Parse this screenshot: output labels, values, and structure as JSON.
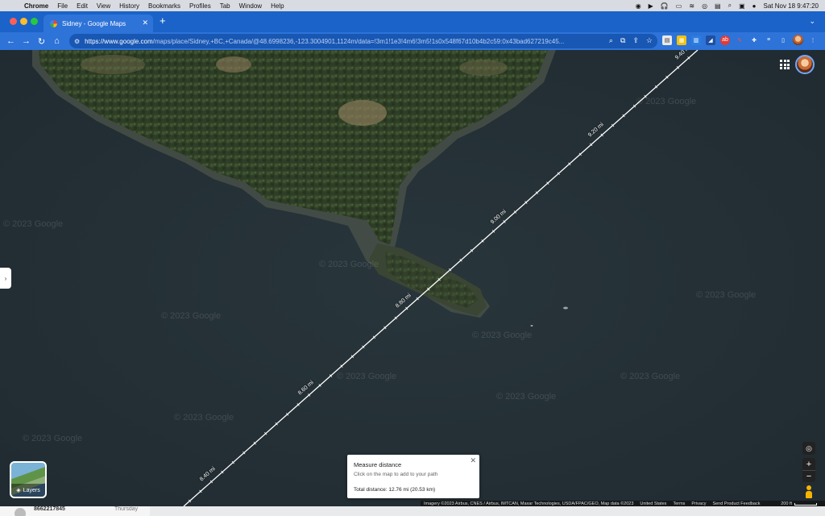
{
  "menubar": {
    "items": [
      "Chrome",
      "File",
      "Edit",
      "View",
      "History",
      "Bookmarks",
      "Profiles",
      "Tab",
      "Window",
      "Help"
    ],
    "datetime": "Sat Nov 18  9:47:20"
  },
  "tab": {
    "title": "Sidney - Google Maps"
  },
  "address_bar": {
    "url_host": "https://www.google.com",
    "url_rest": "/maps/place/Sidney,+BC,+Canada/@48.6998236,-123.3004901,1124m/data=!3m1!1e3!4m6!3m5!1s0x548f67d10b4b2c59:0x43bad627219c45..."
  },
  "map": {
    "watermark": "© 2023 Google",
    "ruler_labels": [
      "8.40 mi",
      "8.60 mi",
      "8.80 mi",
      "9.00 mi",
      "9.20 mi",
      "9.40 mi"
    ],
    "layers_label": "Layers"
  },
  "measure_panel": {
    "title": "Measure distance",
    "hint": "Click on the map to add to your path",
    "total": "Total distance: 12.76 mi (20.53 km)"
  },
  "attribution": {
    "imagery": "Imagery ©2023 Airbus, CNES / Airbus, IMTCAN, Maxar Technologies, USDA/FPAC/GEO, Map data ©2023",
    "links": [
      "United States",
      "Terms",
      "Privacy",
      "Send Product Feedback"
    ],
    "scale": "200 ft"
  },
  "background_app": {
    "number": "8662217845",
    "day": "Thursday"
  },
  "colors": {
    "chrome_blue": "#1b63c8",
    "toolbar_blue": "#2d73d8",
    "water": "#222e35",
    "forest": "#2f3f26"
  }
}
